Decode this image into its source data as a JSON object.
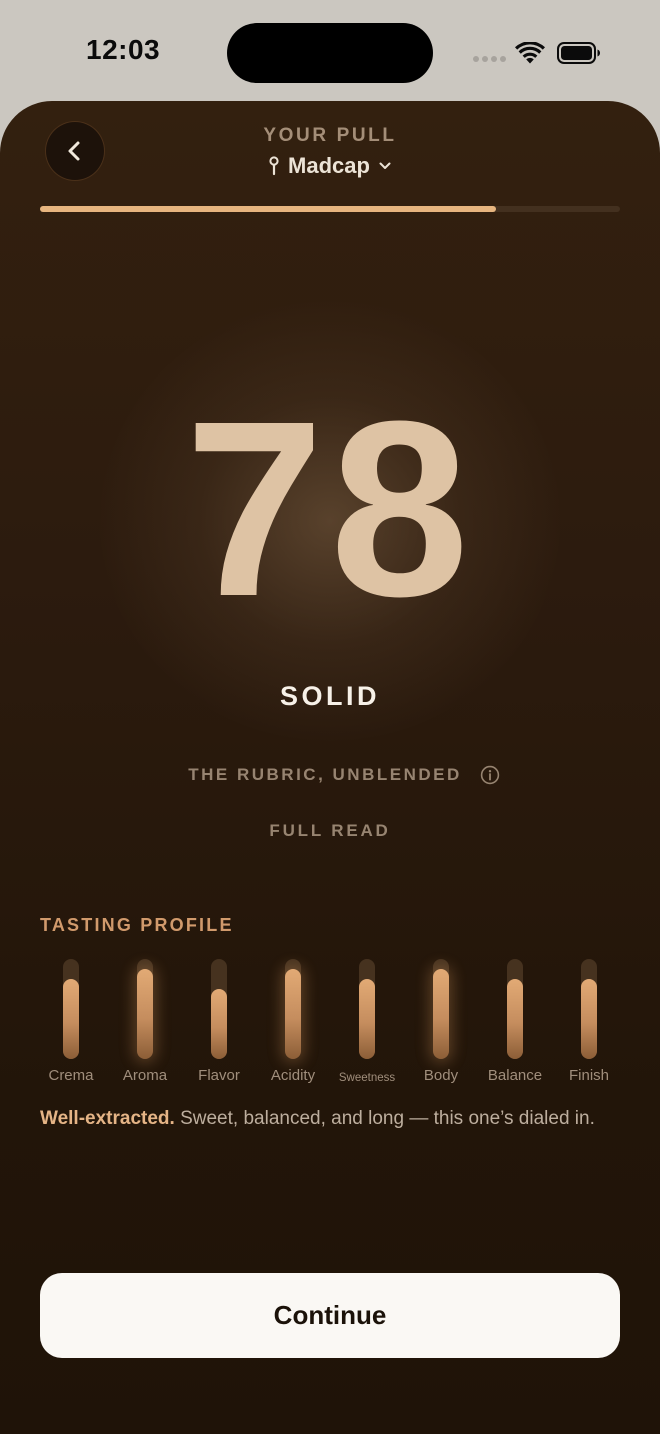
{
  "status_bar": {
    "time": "12:03"
  },
  "header": {
    "eyebrow": "YOUR PULL",
    "location": "Madcap",
    "back_icon": "chevron-left-icon",
    "location_icon": "pin-icon",
    "dropdown_icon": "chevron-down-icon"
  },
  "progress": {
    "fraction": 0.786
  },
  "result": {
    "score": "78",
    "verdict": "SOLID",
    "rubric_label": "THE RUBRIC, UNBLENDED",
    "rubric_icon": "info-icon",
    "full_read": "FULL READ"
  },
  "profile": {
    "title": "TASTING PROFILE",
    "attributes": [
      {
        "label": "Crema",
        "level": 0.8,
        "glow": false
      },
      {
        "label": "Aroma",
        "level": 0.9,
        "glow": true
      },
      {
        "label": "Flavor",
        "level": 0.7,
        "glow": false
      },
      {
        "label": "Acidity",
        "level": 0.9,
        "glow": true
      },
      {
        "label": "Sweetness",
        "level": 0.8,
        "glow": false
      },
      {
        "label": "Body",
        "level": 0.9,
        "glow": true
      },
      {
        "label": "Balance",
        "level": 0.8,
        "glow": false
      },
      {
        "label": "Finish",
        "level": 0.8,
        "glow": false
      }
    ]
  },
  "summary": {
    "lead": "Well-extracted.",
    "body": "Sweet, balanced, and long — this one’s dialed in."
  },
  "actions": {
    "continue_label": "Continue"
  },
  "colors": {
    "accent": "#e7b57f",
    "score": "#dec3a4",
    "background": "#2c1b0e"
  }
}
